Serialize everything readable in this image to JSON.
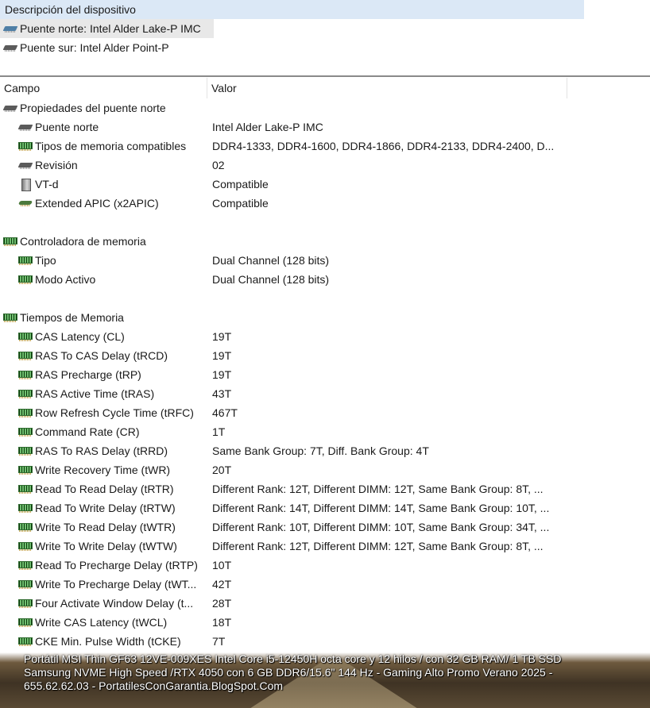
{
  "device": {
    "header": "Descripción del dispositivo",
    "items": [
      {
        "label": "Puente norte: Intel Alder Lake-P IMC",
        "icon": "bridge-blue-icon"
      },
      {
        "label": "Puente sur: Intel Alder Point-P",
        "icon": "bridge-icon"
      }
    ]
  },
  "columns": {
    "field": "Campo",
    "value": "Valor"
  },
  "rows": [
    {
      "field": "Propiedades del puente norte",
      "value": "",
      "icon": "bridge-icon",
      "level": 0
    },
    {
      "field": "Puente norte",
      "value": "Intel Alder Lake-P IMC",
      "icon": "bridge-icon",
      "level": 1
    },
    {
      "field": "Tipos de memoria compatibles",
      "value": "DDR4-1333, DDR4-1600, DDR4-1866, DDR4-2133, DDR4-2400, D...",
      "icon": "memory-chip-icon",
      "level": 1
    },
    {
      "field": "Revisión",
      "value": "02",
      "icon": "bridge-icon",
      "level": 1
    },
    {
      "field": "VT-d",
      "value": "Compatible",
      "icon": "vtd-icon",
      "level": 1
    },
    {
      "field": "Extended APIC (x2APIC)",
      "value": "Compatible",
      "icon": "apic-icon",
      "level": 1
    },
    {
      "field": "",
      "value": "",
      "icon": "",
      "level": 0
    },
    {
      "field": "Controladora de memoria",
      "value": "",
      "icon": "memory-chip-icon",
      "level": 0
    },
    {
      "field": "Tipo",
      "value": "Dual Channel  (128 bits)",
      "icon": "memory-chip-icon",
      "level": 1
    },
    {
      "field": "Modo Activo",
      "value": "Dual Channel  (128 bits)",
      "icon": "memory-chip-icon",
      "level": 1
    },
    {
      "field": "",
      "value": "",
      "icon": "",
      "level": 0
    },
    {
      "field": "Tiempos de Memoria",
      "value": "",
      "icon": "memory-chip-icon",
      "level": 0
    },
    {
      "field": "CAS Latency (CL)",
      "value": "19T",
      "icon": "memory-chip-icon",
      "level": 1
    },
    {
      "field": "RAS To CAS Delay (tRCD)",
      "value": "19T",
      "icon": "memory-chip-icon",
      "level": 1
    },
    {
      "field": "RAS Precharge (tRP)",
      "value": "19T",
      "icon": "memory-chip-icon",
      "level": 1
    },
    {
      "field": "RAS Active Time (tRAS)",
      "value": "43T",
      "icon": "memory-chip-icon",
      "level": 1
    },
    {
      "field": "Row Refresh Cycle Time (tRFC)",
      "value": "467T",
      "icon": "memory-chip-icon",
      "level": 1
    },
    {
      "field": "Command Rate (CR)",
      "value": "1T",
      "icon": "memory-chip-icon",
      "level": 1
    },
    {
      "field": "RAS To RAS Delay (tRRD)",
      "value": "Same Bank Group: 7T, Diff. Bank Group: 4T",
      "icon": "memory-chip-icon",
      "level": 1
    },
    {
      "field": "Write Recovery Time (tWR)",
      "value": "20T",
      "icon": "memory-chip-icon",
      "level": 1
    },
    {
      "field": "Read To Read Delay (tRTR)",
      "value": "Different Rank: 12T, Different DIMM: 12T, Same Bank Group: 8T, ...",
      "icon": "memory-chip-icon",
      "level": 1
    },
    {
      "field": "Read To Write Delay (tRTW)",
      "value": "Different Rank: 14T, Different DIMM: 14T, Same Bank Group: 10T, ...",
      "icon": "memory-chip-icon",
      "level": 1
    },
    {
      "field": "Write To Read Delay (tWTR)",
      "value": "Different Rank: 10T, Different DIMM: 10T, Same Bank Group: 34T, ...",
      "icon": "memory-chip-icon",
      "level": 1
    },
    {
      "field": "Write To Write Delay (tWTW)",
      "value": "Different Rank: 12T, Different DIMM: 12T, Same Bank Group: 8T, ...",
      "icon": "memory-chip-icon",
      "level": 1
    },
    {
      "field": "Read To Precharge Delay (tRTP)",
      "value": "10T",
      "icon": "memory-chip-icon",
      "level": 1
    },
    {
      "field": "Write To Precharge Delay (tWT...",
      "value": "42T",
      "icon": "memory-chip-icon",
      "level": 1
    },
    {
      "field": "Four Activate Window Delay (t...",
      "value": "28T",
      "icon": "memory-chip-icon",
      "level": 1
    },
    {
      "field": "Write CAS Latency (tWCL)",
      "value": "18T",
      "icon": "memory-chip-icon",
      "level": 1
    },
    {
      "field": "CKE Min. Pulse Width (tCKE)",
      "value": "7T",
      "icon": "memory-chip-icon",
      "level": 1
    }
  ],
  "caption": {
    "line1": "Portátil MSI Thin GF63 12VE-009XES Intel Core i5-12450H octa core y 12 hilos / con 32 GB RAM/ 1 TB  SSD",
    "line2": "Samsung NVME High Speed /RTX 4050 con 6 GB DDR6/15.6\" 144 Hz - Gaming Alto Promo Verano 2025 -",
    "line3": "655.62.62.03 - PortatilesConGarantia.BlogSpot.Com"
  }
}
